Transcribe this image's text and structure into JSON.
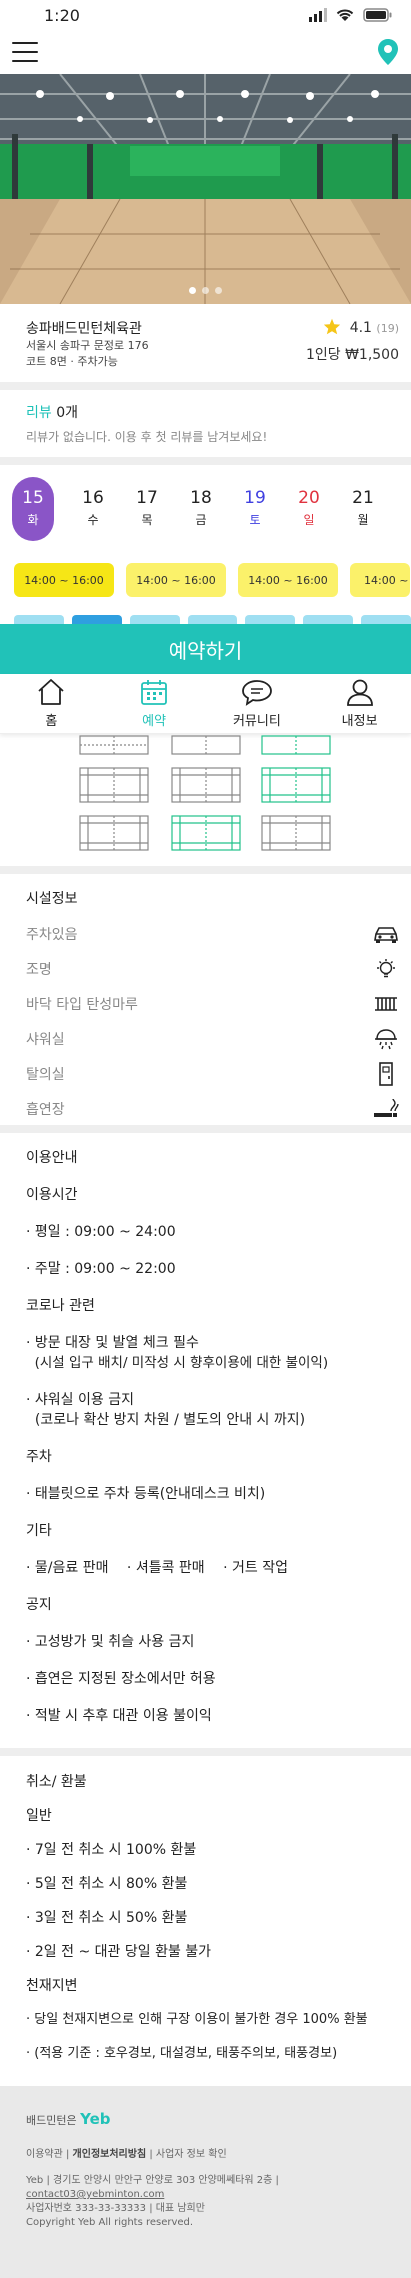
{
  "status_bar": {
    "time": "1:20"
  },
  "venue": {
    "name": "송파배드민턴체육관",
    "address": "서울시 송파구 문정로 176",
    "details": "코트 8면 · 주차가능",
    "rating": "4.1",
    "rating_count": "(19)",
    "price": "1인당 ₩1,500"
  },
  "review": {
    "label": "리뷰",
    "count": "0개",
    "empty_text": "리뷰가 없습니다. 이용 후 첫 리뷰를 남겨보세요!"
  },
  "dates": [
    {
      "day": "15",
      "weekday": "화",
      "selected": true
    },
    {
      "day": "16",
      "weekday": "수"
    },
    {
      "day": "17",
      "weekday": "목"
    },
    {
      "day": "18",
      "weekday": "금"
    },
    {
      "day": "19",
      "weekday": "토"
    },
    {
      "day": "20",
      "weekday": "일"
    },
    {
      "day": "21",
      "weekday": "월"
    }
  ],
  "slots": [
    "14:00 ~ 16:00",
    "14:00 ~ 16:00",
    "14:00 ~ 16:00",
    "14:00 ~ 16:00"
  ],
  "slot_last_partial": "14:00 ~",
  "reserve_button": "예약하기",
  "tabbar": [
    {
      "label": "홈",
      "icon": "home-icon"
    },
    {
      "label": "예약",
      "icon": "calendar-icon",
      "active": true
    },
    {
      "label": "커뮤니티",
      "icon": "chat-icon"
    },
    {
      "label": "내정보",
      "icon": "user-icon"
    }
  ],
  "facility": {
    "title": "시설정보",
    "items": [
      {
        "label": "주차있음",
        "icon": "car-icon"
      },
      {
        "label": "조명",
        "icon": "bulb-icon"
      },
      {
        "label": "바닥 타입 탄성마루",
        "icon": "floor-icon"
      },
      {
        "label": "샤워실",
        "icon": "shower-icon"
      },
      {
        "label": "탈의실",
        "icon": "locker-icon"
      },
      {
        "label": "흡연장",
        "icon": "smoking-icon"
      }
    ]
  },
  "usage": {
    "title": "이용안내",
    "hours_title": "이용시간",
    "weekday": "· 평일 : 09:00 ~ 24:00",
    "weekend": "· 주말 : 09:00 ~ 22:00",
    "corona_title": "코로나 관련",
    "corona_1a": "· 방문 대장 및 발열 체크 필수",
    "corona_1b": "  (시설 입구 배치/ 미작성 시 향후이용에 대한 불이익)",
    "corona_2a": "· 샤워실 이용 금지",
    "corona_2b": "  (코로나 확산 방지 차원 / 별도의 안내 시 까지)",
    "parking_title": "주차",
    "parking_1": "· 태블릿으로 주차 등록(안내데스크 비치)",
    "etc_title": "기타",
    "etc_1": "· 물/음료 판매",
    "etc_2": "· 셔틀콕 판매",
    "etc_3": "· 거트 작업",
    "notice_title": "공지",
    "notice_1": "· 고성방가 및 취슬 사용 금지",
    "notice_2": "· 흡연은 지정된 장소에서만 허용",
    "notice_3": "· 적발 시 추후 대관 이용 불이익"
  },
  "refund": {
    "title": "취소/ 환불",
    "general_title": "일반",
    "r1": "· 7일 전 취소 시 100% 환불",
    "r2": "· 5일 전 취소 시 80% 환불",
    "r3": "· 3일 전 취소 시 50% 환불",
    "r4": "· 2일 전 ~ 대관 당일 환불 불가",
    "disaster_title": "천재지변",
    "d1": "· 당일 천재지변으로 인해 구장 이용이 불가한 경우 100% 환불",
    "d2": "· (적용 기준 : 호우경보, 대설경보, 태풍주의보, 태풍경보)"
  },
  "footer": {
    "brand_prefix": "배드민턴은",
    "brand_name": "Yeb",
    "link_terms": "이용약관",
    "link_privacy": "개인정보처리방침",
    "link_business": "사업자 정보 확인",
    "line1": "Yeb  |  경기도 안양시 만안구 안양로 303 안양메쎄타워 2층  |",
    "line2": "contact03@yebminton.com",
    "line3": "사업자번호 333-33-33333  |  대표 남희만",
    "line4": "Copyright Yeb All rights reserved."
  },
  "colors": {
    "accent": "#21c2b8",
    "selected_date": "#8a55c7",
    "slot": "#fbf16a"
  }
}
